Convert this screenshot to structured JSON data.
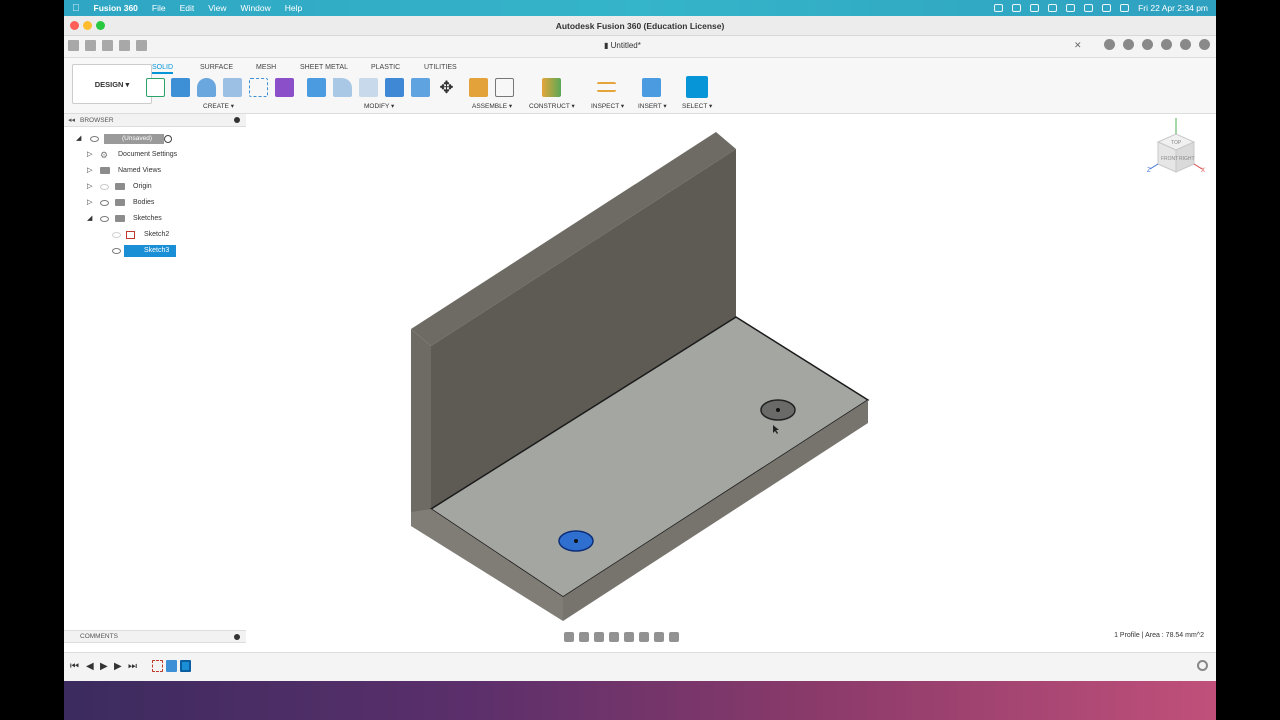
{
  "menubar": {
    "app": "Fusion 360",
    "items": [
      "File",
      "Edit",
      "View",
      "Window",
      "Help"
    ],
    "clock": "Fri 22 Apr  2:34 pm"
  },
  "window": {
    "title": "Autodesk Fusion 360 (Education License)",
    "doc_tab": "Untitled*"
  },
  "toolbar": {
    "workspace": "DESIGN",
    "tabs": [
      "SOLID",
      "SURFACE",
      "MESH",
      "SHEET METAL",
      "PLASTIC",
      "UTILITIES"
    ],
    "active_tab": "SOLID",
    "groups": [
      "CREATE",
      "MODIFY",
      "ASSEMBLE",
      "CONSTRUCT",
      "INSPECT",
      "INSERT",
      "SELECT"
    ]
  },
  "browser": {
    "header": "BROWSER",
    "root": "(Unsaved)",
    "items": [
      "Document Settings",
      "Named Views",
      "Origin",
      "Bodies",
      "Sketches"
    ],
    "sketches": [
      "Sketch2",
      "Sketch3"
    ]
  },
  "viewcube": {
    "labels": [
      "TOP",
      "FRONT",
      "RIGHT"
    ],
    "axes": [
      "Z",
      "X"
    ]
  },
  "comments": {
    "header": "COMMENTS"
  },
  "status": {
    "text": "1 Profile | Area : 78.54 mm^2"
  },
  "colors": {
    "accent": "#0696d7",
    "selection": "#1a8fd6",
    "body": "#8a8a86"
  }
}
